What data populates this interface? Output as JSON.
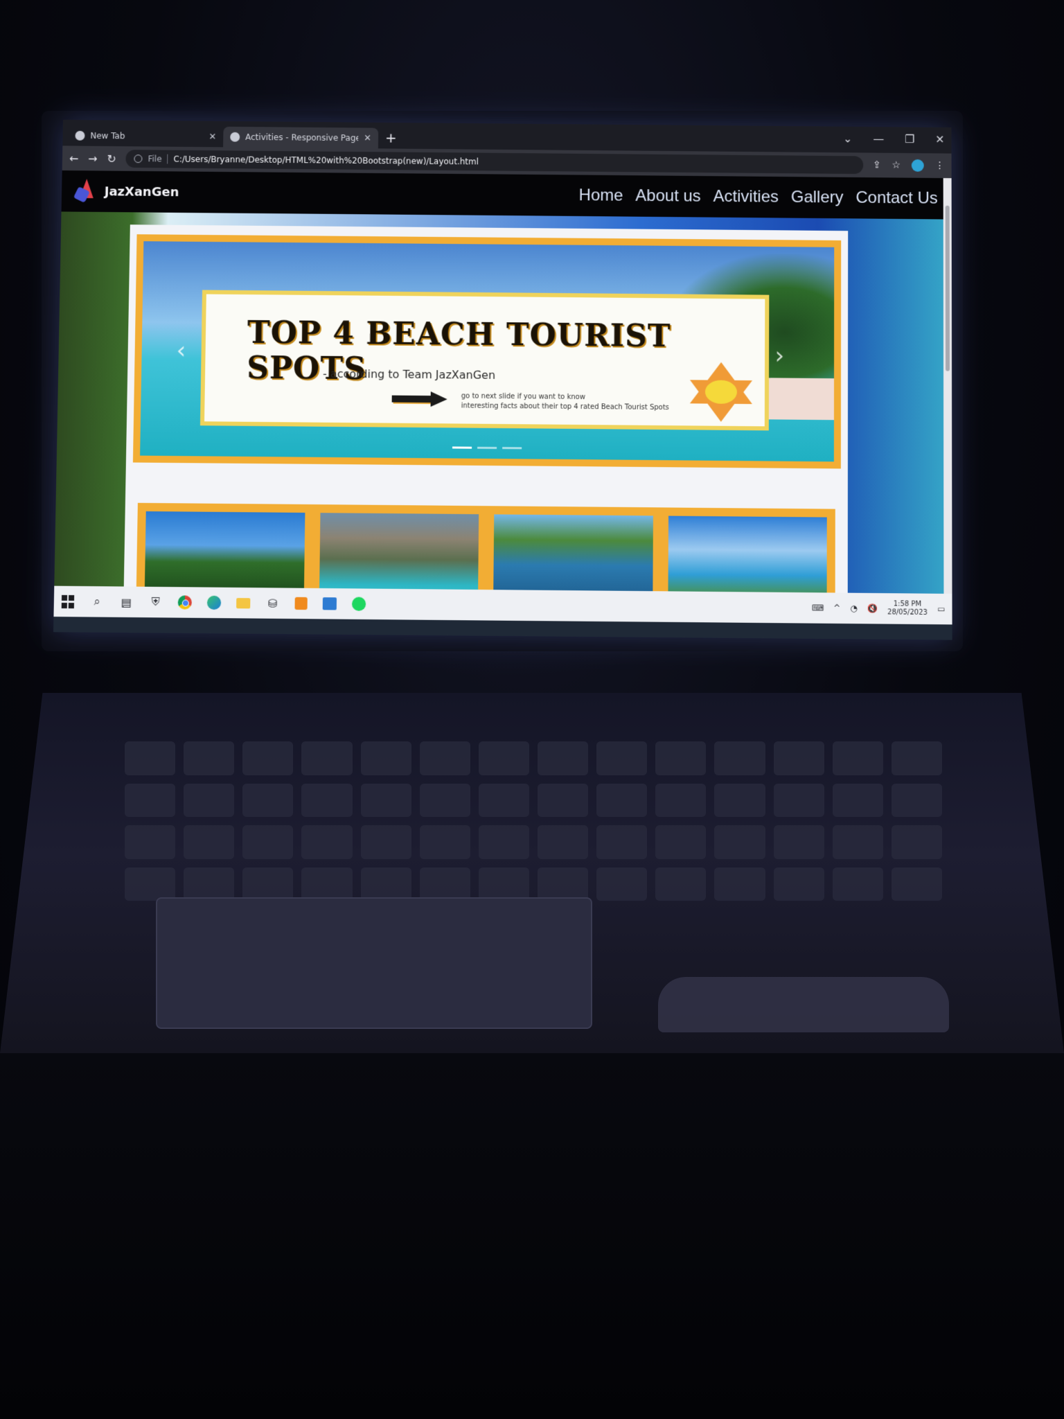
{
  "browser": {
    "tabs": [
      {
        "label": "New Tab",
        "active": false
      },
      {
        "label": "Activities - Responsive Page Lay",
        "active": true
      }
    ],
    "url_scheme": "File",
    "url": "C:/Users/Bryanne/Desktop/HTML%20with%20Bootstrap(new)/Layout.html",
    "icons": {
      "back": "←",
      "forward": "→",
      "reload": "↻",
      "share": "⇪",
      "star": "☆",
      "menu": "⋮",
      "tab_search": "⌄",
      "minimize": "—",
      "restore": "❐",
      "close": "✕",
      "new_tab": "+"
    }
  },
  "site": {
    "brand": "JazXanGen",
    "nav": [
      "Home",
      "About us",
      "Activities",
      "Gallery",
      "Contact Us"
    ]
  },
  "carousel": {
    "title": "TOP 4 BEACH TOURIST SPOTS",
    "subtitle": "- according to Team JazXanGen",
    "note_line1": "go to next slide if you want to know",
    "note_line2": "interesting facts about their top 4 rated Beach Tourist Spots",
    "prev": "‹",
    "next": "›",
    "slide_count": 3,
    "active_slide": 1
  },
  "taskbar": {
    "time": "1:58 PM",
    "date": "28/05/2023",
    "search_icon": "⌕",
    "tray": {
      "chevron": "^",
      "volume": "🔇",
      "wifi": "◔",
      "notif": "▭"
    }
  },
  "colors": {
    "accent": "#f2ad34",
    "card_border": "#efd35b",
    "nav_bg": "#050507"
  }
}
